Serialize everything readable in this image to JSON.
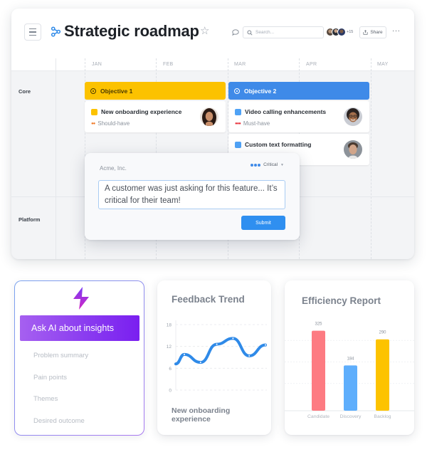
{
  "roadmap": {
    "title": "Strategic roadmap",
    "search_placeholder": "Search...",
    "collaborators_more": "+15",
    "share_label": "Share",
    "more_label": "···",
    "months": [
      "JAN",
      "FEB",
      "MAR",
      "APR",
      "MAY"
    ],
    "rows": [
      "Core",
      "Platform"
    ],
    "objectives": [
      {
        "label": "Objective 1",
        "color": "#fcc200"
      },
      {
        "label": "Objective 2",
        "color": "#3f8ae8"
      }
    ],
    "features": [
      {
        "title": "New onboarding experience",
        "priority": "Should-have",
        "color": "#fcc200",
        "priority_color": "#f07a28"
      },
      {
        "title": "Video calling enhancements",
        "priority": "Must-have",
        "color": "#4fa2f5",
        "priority_color": "#e8303a"
      },
      {
        "title": "Custom text formatting",
        "priority": "",
        "color": "#4fa2f5"
      }
    ]
  },
  "feedback": {
    "company": "Acme, Inc.",
    "priority": "Critical",
    "text": "A customer was just asking for this feature... It’s critical for their team!",
    "submit_label": "Submit"
  },
  "ai": {
    "button_label": "Ask AI about insights",
    "items": [
      "Problem summary",
      "Pain points",
      "Themes",
      "Desired outcome"
    ]
  },
  "trend": {
    "title": "Feedback Trend",
    "subtitle": "New onboarding experience"
  },
  "efficiency": {
    "title": "Efficiency Report"
  },
  "chart_data": [
    {
      "type": "line",
      "title": "Feedback Trend",
      "subtitle": "New onboarding experience",
      "x": [
        0,
        1,
        2,
        3,
        4,
        5,
        6
      ],
      "values": [
        9.8,
        7.6,
        12.6,
        14.2,
        9.4,
        12.4
      ],
      "y_ticks": [
        "0",
        "6",
        "12",
        "18"
      ],
      "ylim": [
        0,
        18
      ],
      "grid": true,
      "color": "#2f8ae8"
    },
    {
      "type": "bar",
      "title": "Efficiency Report",
      "categories": [
        "Candidate",
        "Discovery",
        "Backlog"
      ],
      "values": [
        325,
        184,
        290
      ],
      "labels": [
        "325",
        "184",
        "290"
      ],
      "colors": [
        "#fd7b82",
        "#5eaefc",
        "#fdc300"
      ],
      "grid": true
    }
  ]
}
